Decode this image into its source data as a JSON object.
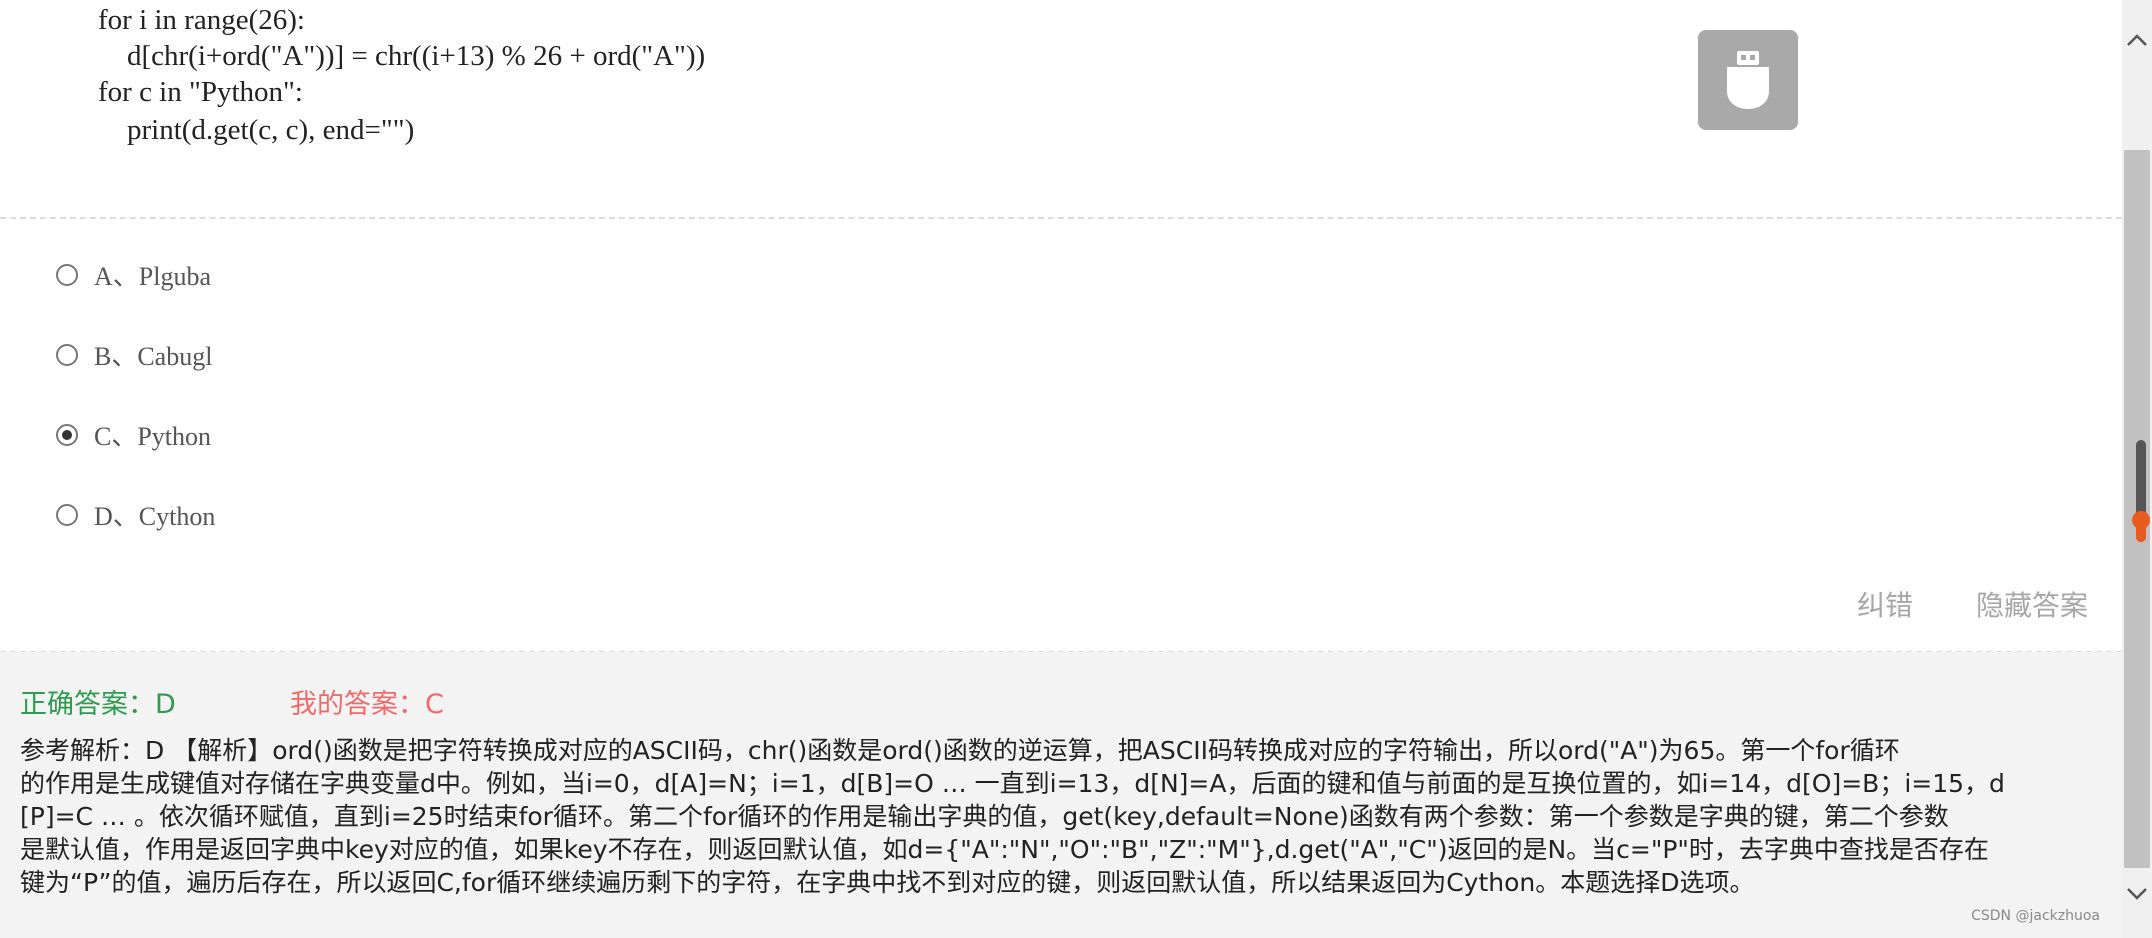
{
  "code": {
    "lines": [
      "for i in range(26):",
      "    d[chr(i+ord(\"A\"))] = chr((i+13) % 26 + ord(\"A\"))",
      "for c in \"Python\":",
      "    print(d.get(c, c), end=\"\")"
    ]
  },
  "options": [
    {
      "label": "A、Plguba",
      "selected": false
    },
    {
      "label": "B、Cabugl",
      "selected": false
    },
    {
      "label": "C、Python",
      "selected": true
    },
    {
      "label": "D、Cython",
      "selected": false
    }
  ],
  "actions": {
    "report_error": "纠错",
    "hide_answer": "隐藏答案"
  },
  "result": {
    "correct_answer": "正确答案：D",
    "my_answer": "我的答案：C"
  },
  "analysis": {
    "lines": [
      "参考解析：D 【解析】ord()函数是把字符转换成对应的ASCII码，chr()函数是ord()函数的逆运算，把ASCII码转换成对应的字符输出，所以ord(\"A\")为65。第一个for循环",
      "的作用是生成键值对存储在字典变量d中。例如，当i=0，d[A]=N；i=1，d[B]=O … 一直到i=13，d[N]=A，后面的键和值与前面的是互换位置的，如i=14，d[O]=B；i=15，d",
      "[P]=C … 。依次循环赋值，直到i=25时结束for循环。第二个for循环的作用是输出字典的值，get(key,default=None)函数有两个参数：第一个参数是字典的键，第二个参数",
      "是默认值，作用是返回字典中key对应的值，如果key不存在，则返回默认值，如d={\"A\":\"N\",\"O\":\"B\",\"Z\":\"M\"},d.get(\"A\",\"C\")返回的是N。当c=\"P\"时，去字典中查找是否存在",
      "键为“P”的值，遍历后存在，所以返回C,for循环继续遍历剩下的字符，在字典中找不到对应的键，则返回默认值，所以结果返回为Cython。本题选择D选项。"
    ]
  },
  "widgets": {
    "usb_icon": "usb-drive-icon",
    "volume_level": 0.22
  },
  "watermark": "CSDN @jackzhuoa",
  "colors": {
    "correct": "#2e9b4f",
    "mine": "#f06a6a",
    "accent": "#e85d1f"
  }
}
